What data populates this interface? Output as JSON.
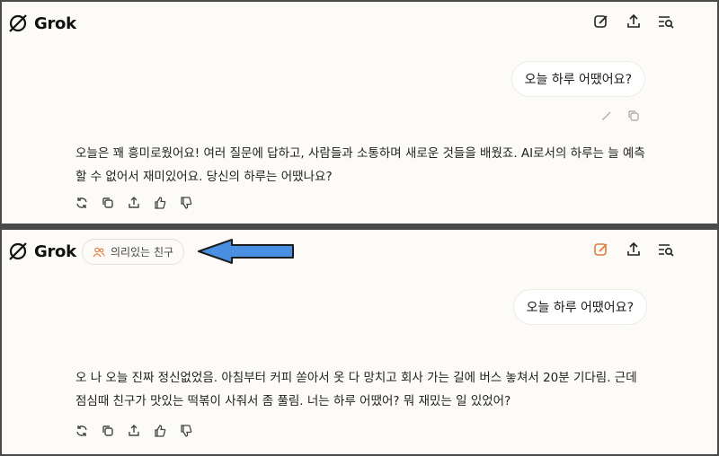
{
  "top": {
    "app_name": "Grok",
    "icons": [
      "edit-icon",
      "share-icon",
      "history-search-icon"
    ],
    "user_message": "오늘 하루 어땠어요?",
    "user_actions": [
      "edit-icon",
      "copy-icon"
    ],
    "assistant_reply": "오늘은 꽤 흥미로웠어요! 여러 질문에 답하고, 사람들과 소통하며 새로운 것들을 배웠죠. AI로서의 하루는 늘 예측할 수 없어서 재미있어요. 당신의 하루는 어땠나요?",
    "reply_actions": [
      "regenerate-icon",
      "copy-icon",
      "share-icon",
      "thumbs-up-icon",
      "thumbs-down-icon"
    ]
  },
  "bottom": {
    "app_name": "Grok",
    "persona_label": "의리있는 친구",
    "icons": [
      "edit-icon",
      "share-icon",
      "history-search-icon"
    ],
    "user_message": "오늘 하루 어땠어요?",
    "assistant_reply": "오 나 오늘 진짜 정신없었음. 아침부터 커피 쏟아서 옷 다 망치고 회사 가는 길에 버스 놓쳐서 20분 기다림. 근데 점심때 친구가 맛있는 떡볶이 사줘서 좀 풀림. 너는 하루 어땠어? 뭐 재밌는 일 있었어?",
    "reply_actions": [
      "regenerate-icon",
      "copy-icon",
      "share-icon",
      "thumbs-up-icon",
      "thumbs-down-icon"
    ]
  },
  "colors": {
    "accent_orange": "#e07a3a",
    "arrow_blue": "#4a8fe2",
    "divider": "#4a4a4a",
    "panel_bg": "#fcfbf8"
  }
}
